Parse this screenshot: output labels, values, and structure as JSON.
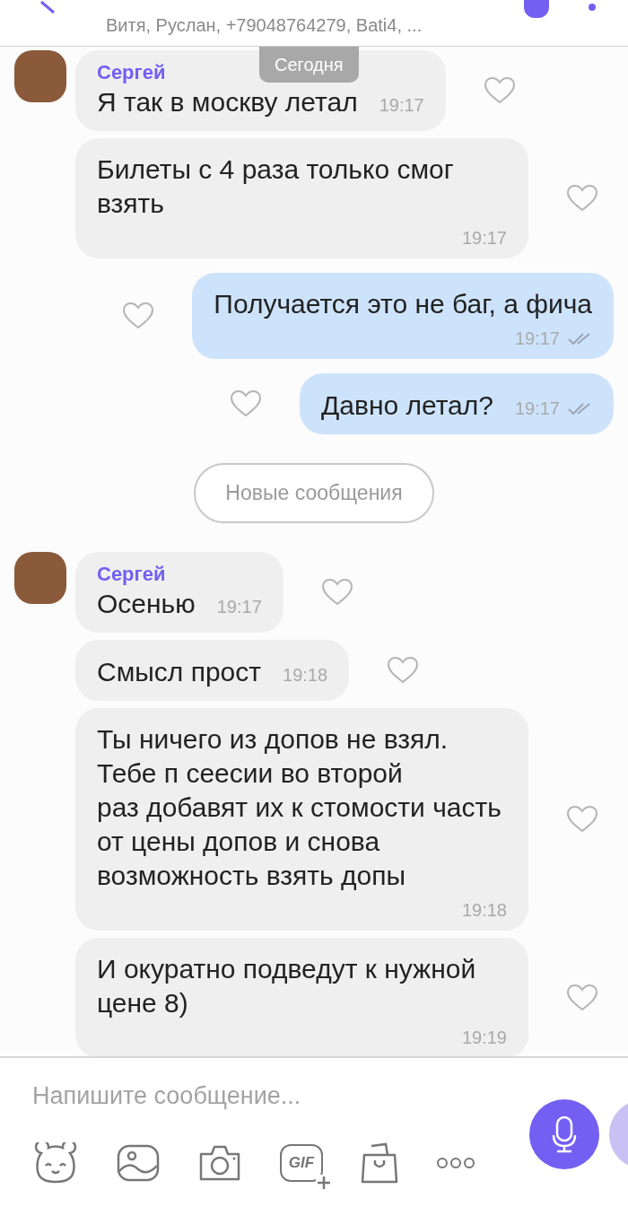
{
  "header": {
    "subtitle": "Витя, Руслан, +79048764279, Bati4, ..."
  },
  "date_badge": "Сегодня",
  "messages": [
    {
      "kind": "incoming",
      "sender": "Сергей",
      "text": "Я так в москву летал",
      "time": "19:17",
      "time_below": false,
      "liked": false
    },
    {
      "kind": "incoming",
      "text": "Билеты с 4 раза только смог взять",
      "time": "19:17",
      "time_below": true,
      "liked": false
    },
    {
      "kind": "outgoing",
      "text": "Получается это не баг, а фича",
      "time": "19:17",
      "time_below": true,
      "liked": false,
      "read": true
    },
    {
      "kind": "outgoing",
      "text": "Давно летал?",
      "time": "19:17",
      "time_below": false,
      "liked": false,
      "read": true
    },
    {
      "kind": "divider",
      "text": "Новые сообщения"
    },
    {
      "kind": "incoming",
      "sender": "Сергей",
      "text": "Осенью",
      "time": "19:17",
      "time_below": false,
      "liked": false
    },
    {
      "kind": "incoming",
      "text": "Смысл прост",
      "time": "19:18",
      "time_below": false,
      "liked": false
    },
    {
      "kind": "incoming",
      "text": "Ты ничего из допов не взял. Тебе п сеесии во второй\nраз добавят их к стомости часть от цены допов и снова возможность взять допы",
      "time": "19:18",
      "time_below": true,
      "liked": false
    },
    {
      "kind": "incoming",
      "text": "И окуратно подведут к нужной цене 8)",
      "time": "19:19",
      "time_below": true,
      "liked": false
    }
  ],
  "composer": {
    "placeholder": "Напишите сообщение...",
    "gif_label": "GIF"
  }
}
